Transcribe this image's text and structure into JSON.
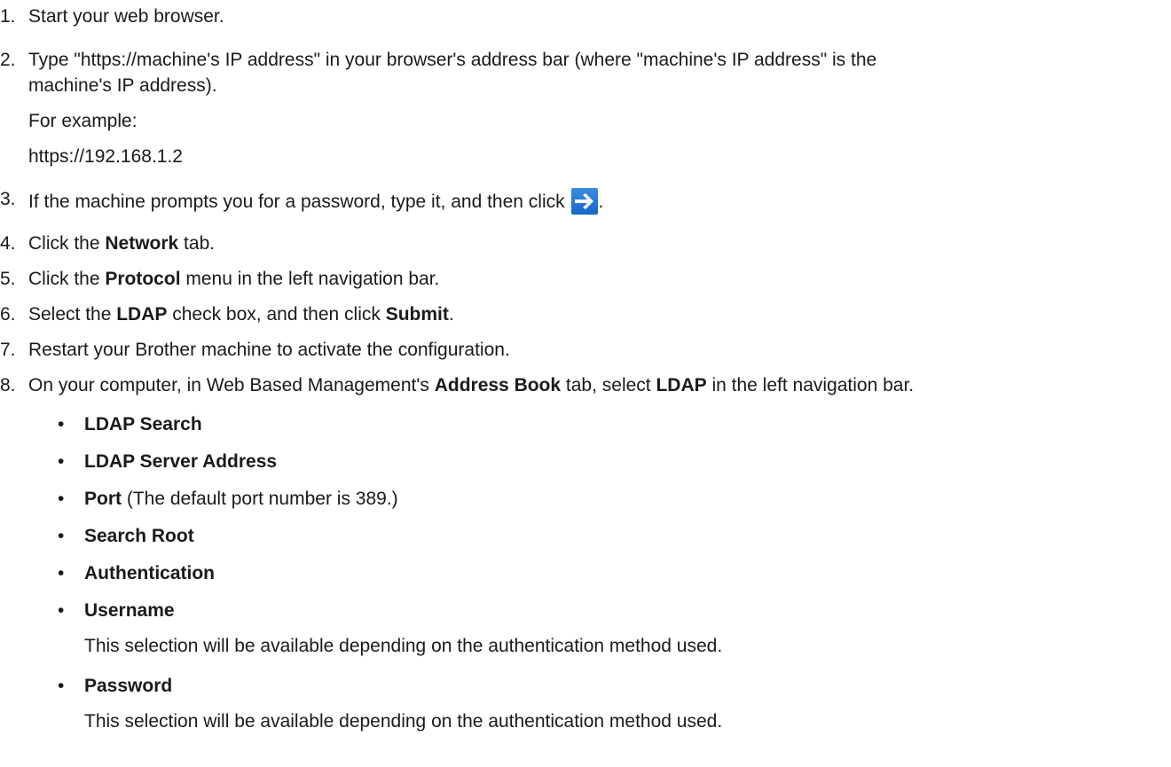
{
  "steps": [
    {
      "num": "1.",
      "text": "Start your web browser."
    },
    {
      "num": "2.",
      "line1": "Type \"https://machine's IP address\" in your browser's address bar (where \"machine's IP address\" is the",
      "line2": "machine's IP address).",
      "example_label": "For example:",
      "example_url": "https://192.168.1.2"
    },
    {
      "num": "3.",
      "text": "If the machine prompts you for a password, type it, and then click",
      "after": "."
    },
    {
      "num": "4.",
      "pre": "Click the ",
      "bold": "Network",
      "post": " tab."
    },
    {
      "num": "5.",
      "pre": "Click the ",
      "bold": "Protocol",
      "post": " menu in the left navigation bar."
    },
    {
      "num": "6.",
      "pre": "Select the ",
      "bold": "LDAP",
      "mid": " check box, and then click ",
      "bold2": "Submit",
      "post": "."
    },
    {
      "num": "7.",
      "text": "Restart your Brother machine to activate the configuration."
    },
    {
      "num": "8.",
      "pre": "On your computer, in Web Based Management's ",
      "bold": "Address Book",
      "mid": " tab, select ",
      "bold2": "LDAP",
      "post": " in the left navigation bar."
    }
  ],
  "bullets": [
    {
      "bold": "LDAP Search"
    },
    {
      "bold": "LDAP Server Address"
    },
    {
      "bold": "Port",
      "rest": " (The default port number is 389.)"
    },
    {
      "bold": "Search Root"
    },
    {
      "bold": "Authentication"
    },
    {
      "bold": "Username",
      "note": "This selection will be available depending on the authentication method used."
    },
    {
      "bold": "Password",
      "note": "This selection will be available depending on the authentication method used."
    }
  ],
  "bullet_char": "•",
  "icons": {
    "submit_arrow": "right-arrow-icon"
  }
}
